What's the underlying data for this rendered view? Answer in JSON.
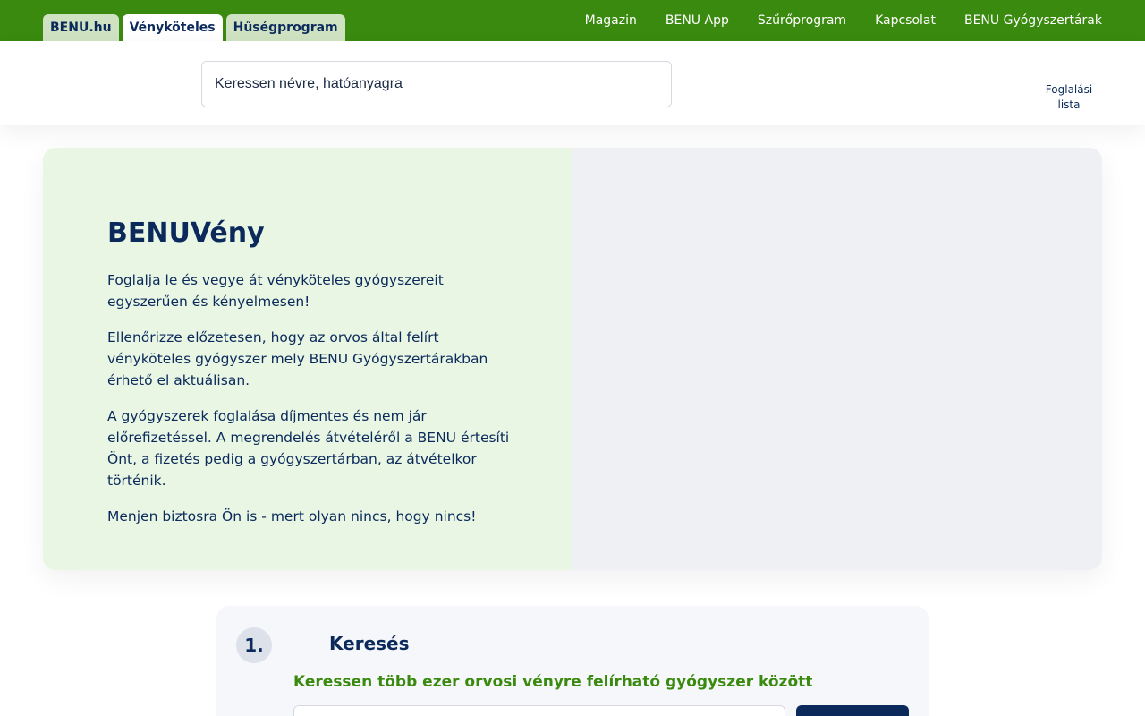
{
  "site_tabs": [
    {
      "label": "BENU.hu",
      "active": false
    },
    {
      "label": "Vényköteles",
      "active": true
    },
    {
      "label": "Hűségprogram",
      "active": false
    }
  ],
  "top_links": [
    "Magazin",
    "BENU App",
    "Szűrőprogram",
    "Kapcsolat",
    "BENU Gyógyszertárak"
  ],
  "header": {
    "search_placeholder": "Keressen névre, hatóanyagra",
    "booking_list_line1": "Foglalási",
    "booking_list_line2": "lista"
  },
  "hero": {
    "title": "BENUVény",
    "paragraphs": [
      "Foglalja le és vegye át vényköteles gyógyszereit egyszerűen és kényelmesen!",
      "Ellenőrizze előzetesen, hogy az orvos által felírt vényköteles gyógyszer mely BENU Gyógyszertárakban érhető el aktuálisan.",
      "A gyógyszerek foglalása díjmentes és nem jár előrefizetéssel. A megrendelés átvételéről a BENU értesíti Önt, a fizetés pedig a gyógyszertárban, az átvételkor történik.",
      "Menjen biztosra Ön is - mert olyan nincs, hogy nincs!"
    ]
  },
  "step1": {
    "number": "1.",
    "title": "Keresés",
    "subtitle": "Keressen több ezer orvosi vényre felírható gyógyszer között"
  },
  "colors": {
    "brand_green": "#3a8a0f",
    "navy": "#0b2a5b",
    "hero_green_bg": "#e8f6e3"
  }
}
